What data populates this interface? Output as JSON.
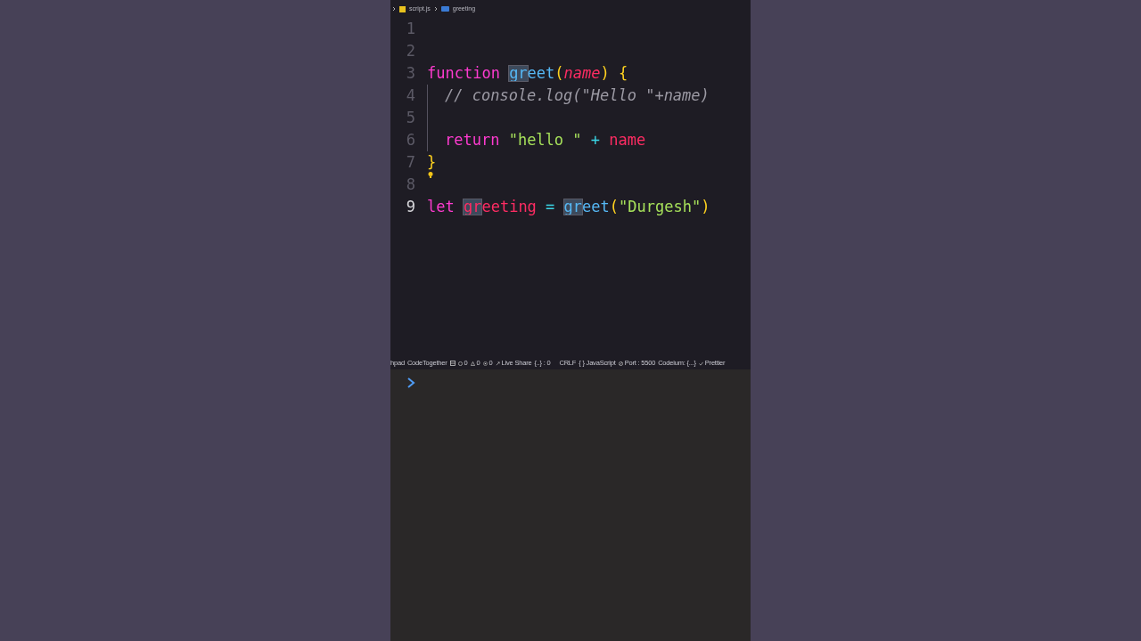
{
  "breadcrumb": [
    {
      "kind": "file",
      "text": "script.js"
    },
    {
      "kind": "symbol",
      "text": "greeting"
    }
  ],
  "lines": [
    {
      "number": "1",
      "current": false,
      "indented": false
    },
    {
      "number": "2",
      "current": false,
      "indented": false
    },
    {
      "number": "3",
      "current": false,
      "indented": false,
      "tokens": [
        {
          "text": "function ",
          "kind": "keyword",
          "highlight": false
        },
        {
          "text": "gr",
          "kind": "function",
          "highlight": true
        },
        {
          "text": "eet",
          "kind": "function",
          "highlight": false
        },
        {
          "text": "(",
          "kind": "bracket",
          "highlight": false
        },
        {
          "text": "name",
          "kind": "param",
          "highlight": false
        },
        {
          "text": ") ",
          "kind": "bracket",
          "highlight": false
        },
        {
          "text": "{",
          "kind": "bracket",
          "highlight": false
        }
      ]
    },
    {
      "number": "4",
      "current": false,
      "indented": true,
      "tokens": [
        {
          "text": "// console.log(\"Hello \"+name)",
          "kind": "comment",
          "highlight": false
        }
      ]
    },
    {
      "number": "5",
      "current": false,
      "indented": true
    },
    {
      "number": "6",
      "current": false,
      "indented": true,
      "tokens": [
        {
          "text": "return ",
          "kind": "keyword",
          "highlight": false
        },
        {
          "text": "\"hello \" ",
          "kind": "string",
          "highlight": false
        },
        {
          "text": "+ ",
          "kind": "operator",
          "highlight": false
        },
        {
          "text": "name",
          "kind": "variable",
          "highlight": false
        }
      ]
    },
    {
      "number": "7",
      "current": false,
      "indented": false,
      "tokens": [
        {
          "text": "}",
          "kind": "bracket",
          "highlight": false
        }
      ]
    },
    {
      "number": "8",
      "current": false,
      "indented": false
    },
    {
      "number": "9",
      "current": true,
      "indented": false,
      "tokens": [
        {
          "text": "let ",
          "kind": "keyword",
          "highlight": false
        },
        {
          "text": "gr",
          "kind": "variable",
          "highlight": true
        },
        {
          "text": "eeting ",
          "kind": "variable",
          "highlight": false
        },
        {
          "text": "= ",
          "kind": "operator",
          "highlight": false
        },
        {
          "text": "gr",
          "kind": "function",
          "highlight": true
        },
        {
          "text": "eet",
          "kind": "function",
          "highlight": false
        },
        {
          "text": "(",
          "kind": "bracket",
          "highlight": false
        },
        {
          "text": "\"Durgesh\"",
          "kind": "string",
          "highlight": false
        },
        {
          "text": ")",
          "kind": "bracket",
          "highlight": false
        }
      ]
    }
  ],
  "status_bar": [
    {
      "kind": "text",
      "text": "hpad"
    },
    {
      "kind": "text",
      "text": "CodeTogether"
    },
    {
      "kind": "layout"
    },
    {
      "kind": "error",
      "text": "0"
    },
    {
      "kind": "warning",
      "text": "0"
    },
    {
      "kind": "ports",
      "text": "0"
    },
    {
      "kind": "share",
      "text": "Live Share"
    },
    {
      "kind": "text",
      "text": "{..} : 0"
    },
    {
      "kind": "spacer"
    },
    {
      "kind": "text",
      "text": "CRLF"
    },
    {
      "kind": "text",
      "text": "{ } JavaScript"
    },
    {
      "kind": "port",
      "text": "Port : 5500"
    },
    {
      "kind": "text",
      "text": "Codeium: {...}"
    },
    {
      "kind": "check",
      "text": "Prettier"
    }
  ]
}
